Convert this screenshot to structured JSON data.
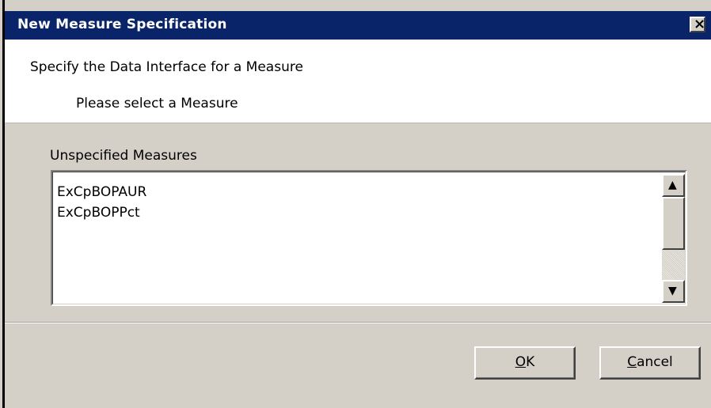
{
  "dialog": {
    "title": "New Measure Specification",
    "close_icon": "close-icon"
  },
  "header": {
    "title": "Specify the Data Interface for a Measure",
    "subtitle": "Please select a Measure"
  },
  "measures": {
    "label": "Unspecified Measures",
    "items": [
      "ExCpBOPAUR",
      "ExCpBOPPct"
    ]
  },
  "scrollbar": {
    "up_icon": "up-arrow-icon",
    "down_icon": "down-arrow-icon"
  },
  "buttons": {
    "ok_mnemonic": "O",
    "ok_rest": "K",
    "cancel_mnemonic": "C",
    "cancel_rest": "ancel"
  },
  "colors": {
    "title_bar": "#0a246a",
    "window_face": "#d4d0c8",
    "header_background": "#ffffff"
  }
}
